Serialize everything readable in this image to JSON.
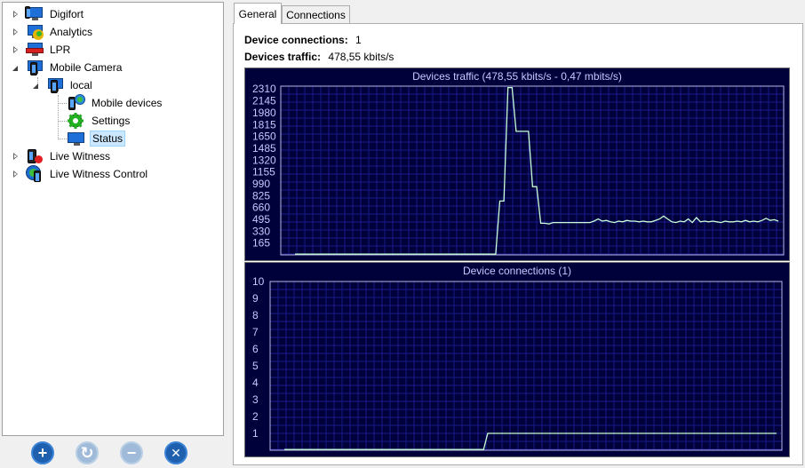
{
  "tree": {
    "items": [
      {
        "label": "Digifort",
        "icon": "digifort-monitor-icon",
        "state": "collapsed"
      },
      {
        "label": "Analytics",
        "icon": "analytics-icon",
        "state": "collapsed"
      },
      {
        "label": "LPR",
        "icon": "lpr-icon",
        "state": "collapsed"
      },
      {
        "label": "Mobile Camera",
        "icon": "mobile-camera-icon",
        "state": "expanded"
      },
      {
        "label": "local",
        "icon": "local-server-icon",
        "state": "expanded"
      },
      {
        "label": "Mobile devices",
        "icon": "mobile-devices-icon"
      },
      {
        "label": "Settings",
        "icon": "settings-gear-icon"
      },
      {
        "label": "Status",
        "icon": "status-monitor-icon",
        "selected": true
      },
      {
        "label": "Live Witness",
        "icon": "live-witness-icon",
        "state": "collapsed"
      },
      {
        "label": "Live Witness Control",
        "icon": "live-witness-control-icon",
        "state": "collapsed"
      }
    ]
  },
  "buttons": {
    "add": "+",
    "refresh": "↻",
    "remove": "−",
    "delete": "✕"
  },
  "tabs": {
    "general": "General",
    "connections": "Connections"
  },
  "stats": {
    "connections_label": "Device connections:",
    "connections_value": "1",
    "traffic_label": "Devices traffic:",
    "traffic_value": "478,55 kbits/s"
  },
  "colors": {
    "chart_bg": "#00003a",
    "chart_grid": "#1a1a8a",
    "chart_line": "#c8ffd8",
    "chart_text": "#c8c8ff"
  },
  "chart_data": [
    {
      "type": "line",
      "title": "Devices traffic (478,55 kbits/s - 0,47 mbits/s)",
      "yticks": [
        "2310",
        "2145",
        "1980",
        "1815",
        "1650",
        "1485",
        "1320",
        "1155",
        "990",
        "825",
        "660",
        "495",
        "330",
        "165"
      ],
      "ylim": [
        0,
        2350
      ],
      "grid": true,
      "series": [
        {
          "values": [
            0,
            0,
            0,
            0,
            0,
            0,
            0,
            0,
            0,
            0,
            0,
            0,
            0,
            0,
            0,
            0,
            0,
            0,
            0,
            0,
            0,
            0,
            0,
            0,
            0,
            0,
            0,
            0,
            0,
            0,
            0,
            0,
            0,
            0,
            0,
            0,
            0,
            0,
            0,
            0,
            0,
            0,
            0,
            0,
            0,
            0,
            0,
            0,
            0,
            0,
            750,
            750,
            2330,
            2330,
            1720,
            1720,
            1720,
            1720,
            950,
            950,
            440,
            440,
            430,
            450,
            450,
            450,
            450,
            450,
            450,
            450,
            450,
            450,
            450,
            470,
            500,
            470,
            480,
            460,
            450,
            470,
            460,
            480,
            470,
            470,
            460,
            470,
            460,
            460,
            480,
            500,
            540,
            500,
            460,
            450,
            470,
            460,
            500,
            450,
            520,
            460,
            470,
            460,
            470,
            460,
            450,
            470,
            460,
            460,
            470,
            460,
            480,
            460,
            470,
            460,
            480,
            510,
            480,
            490,
            470
          ],
          "x_start": 0,
          "x_end": 1
        }
      ]
    },
    {
      "type": "line",
      "title": "Device connections (1)",
      "yticks": [
        "10",
        "9",
        "8",
        "7",
        "6",
        "5",
        "4",
        "3",
        "2",
        "1"
      ],
      "ylim": [
        0,
        10
      ],
      "grid": true,
      "series": [
        {
          "values": [
            0,
            0,
            0,
            0,
            0,
            0,
            0,
            0,
            0,
            0,
            0,
            0,
            0,
            0,
            0,
            0,
            0,
            0,
            0,
            0,
            0,
            0,
            0,
            0,
            0,
            0,
            0,
            0,
            0,
            0,
            0,
            0,
            0,
            0,
            0,
            0,
            0,
            0,
            0,
            0,
            0,
            0,
            0,
            0,
            0,
            0,
            0,
            0,
            0,
            0,
            1,
            1,
            1,
            1,
            1,
            1,
            1,
            1,
            1,
            1,
            1,
            1,
            1,
            1,
            1,
            1,
            1,
            1,
            1,
            1,
            1,
            1,
            1,
            1,
            1,
            1,
            1,
            1,
            1,
            1,
            1,
            1,
            1,
            1,
            1,
            1,
            1,
            1,
            1,
            1,
            1,
            1,
            1,
            1,
            1,
            1,
            1,
            1,
            1,
            1,
            1,
            1,
            1,
            1,
            1,
            1,
            1,
            1,
            1,
            1,
            1,
            1,
            1,
            1,
            1,
            1,
            1,
            1,
            1,
            1,
            1,
            1
          ],
          "x_start": 0,
          "x_end": 1
        }
      ]
    }
  ]
}
